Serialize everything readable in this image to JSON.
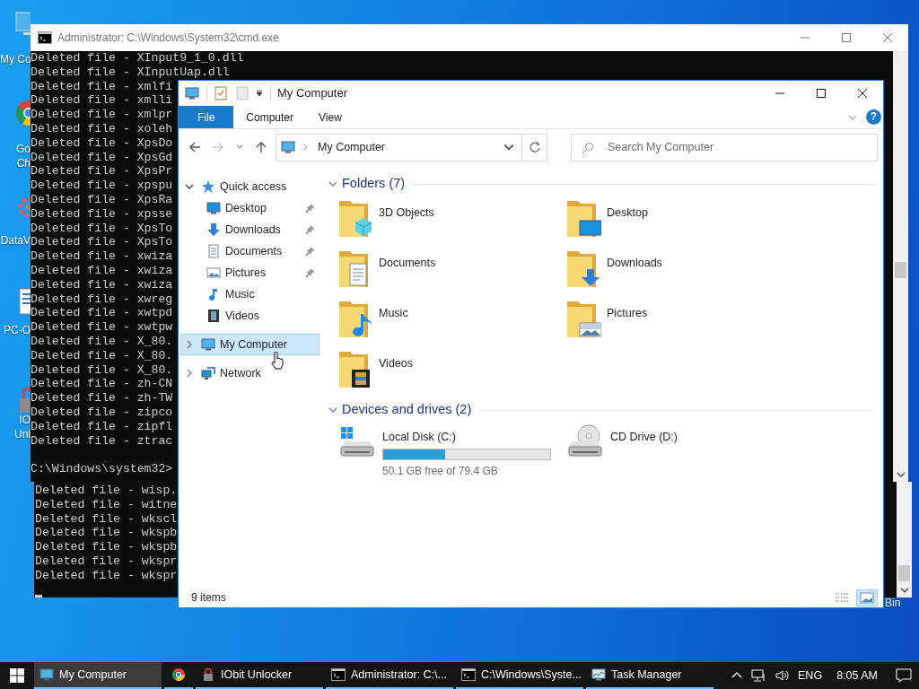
{
  "desktop_icons": [
    {
      "kind": "computer",
      "lines": [
        "My Co"
      ]
    },
    {
      "kind": "browser",
      "lines": [
        "Go",
        "Ch"
      ]
    },
    {
      "kind": "data",
      "lines": [
        "DataV"
      ]
    },
    {
      "kind": "document",
      "lines": [
        "PC-O"
      ]
    },
    {
      "kind": "unlocker",
      "lines": [
        "IO",
        "Unl"
      ]
    },
    {
      "kind": "recycle",
      "lines": [
        "Bin"
      ]
    }
  ],
  "console": {
    "title": "Administrator:  C:\\Windows\\System32\\cmd.exe",
    "lines": [
      "Deleted file - XInput9_1_0.dll",
      "Deleted file - XInputUap.dll",
      "Deleted file - xmlfi",
      "Deleted file - xmlli",
      "Deleted file - xmlpr",
      "Deleted file - xoleh",
      "Deleted file - XpsDo",
      "Deleted file - XpsGd",
      "Deleted file - XpsPr",
      "Deleted file - xpspu",
      "Deleted file - XpsRa",
      "Deleted file - xpsse",
      "Deleted file - XpsTo",
      "Deleted file - XpsTo",
      "Deleted file - xwiza",
      "Deleted file - xwiza",
      "Deleted file - xwiza",
      "Deleted file - xwreg",
      "Deleted file - xwtpd",
      "Deleted file - xwtpw",
      "Deleted file - X_80.",
      "Deleted file - X_80.",
      "Deleted file - X_80.",
      "Deleted file - zh-CN",
      "Deleted file - zh-TW",
      "Deleted file - zipco",
      "Deleted file - zipfl",
      "Deleted file - ztrac"
    ],
    "prompt": "C:\\Windows\\system32>"
  },
  "console_2": {
    "lines": [
      "Deleted file - wisp.",
      "Deleted file - witne",
      "Deleted file - wkscl",
      "Deleted file - wkspb",
      "Deleted file - wkspb",
      "Deleted file - wkspr",
      "Deleted file - wkspr"
    ]
  },
  "explorer": {
    "title": "My Computer",
    "ribbon_tabs": [
      {
        "label": "File",
        "kind": "file"
      },
      {
        "label": "Computer",
        "kind": "tab"
      },
      {
        "label": "View",
        "kind": "tab"
      }
    ],
    "help": "?",
    "address": "My Computer",
    "search": {
      "placeholder": "Search My Computer"
    },
    "nav": [
      {
        "label": "Quick access",
        "kind": "star",
        "expanded": true,
        "selected": false,
        "children": [
          {
            "label": "Desktop",
            "kind": "desktop",
            "pinned": true,
            "selected": false
          },
          {
            "label": "Downloads",
            "kind": "downloads",
            "pinned": true,
            "selected": false
          },
          {
            "label": "Documents",
            "kind": "documents",
            "pinned": true,
            "selected": false
          },
          {
            "label": "Pictures",
            "kind": "pictures",
            "pinned": true,
            "selected": false
          },
          {
            "label": "Music",
            "kind": "music",
            "pinned": false,
            "selected": false
          },
          {
            "label": "Videos",
            "kind": "videos",
            "pinned": false,
            "selected": false
          }
        ]
      },
      {
        "label": "My Computer",
        "kind": "computer",
        "expanded": false,
        "selected": true
      },
      {
        "label": "Network",
        "kind": "network",
        "expanded": false,
        "selected": false
      }
    ],
    "sections": [
      {
        "title": "Folders (7)",
        "expanded": true,
        "items": [
          {
            "label": "3D Objects",
            "kind": "cube"
          },
          {
            "label": "Desktop",
            "kind": "desktop"
          },
          {
            "label": "Documents",
            "kind": "documents"
          },
          {
            "label": "Downloads",
            "kind": "downloads"
          },
          {
            "label": "Music",
            "kind": "music"
          },
          {
            "label": "Pictures",
            "kind": "pictures"
          },
          {
            "label": "Videos",
            "kind": "videos"
          }
        ]
      },
      {
        "title": "Devices and drives (2)",
        "expanded": true,
        "items": [
          {
            "label": "Local Disk (C:)",
            "kind": "disk",
            "level": 0.37,
            "detail": "50.1 GB free of 79.4 GB"
          },
          {
            "label": "CD Drive (D:)",
            "kind": "cd"
          }
        ]
      }
    ],
    "status": "9 items",
    "views": [
      {
        "kind": "details",
        "selected": false
      },
      {
        "kind": "large",
        "selected": true
      }
    ]
  },
  "taskbar": {
    "items": [
      {
        "kind": "explorer",
        "label": "My Computer",
        "selected": true
      },
      {
        "kind": "browser",
        "selected": false
      },
      {
        "kind": "unlocker",
        "label": "IObit Unlocker",
        "selected": false
      },
      {
        "kind": "console",
        "label": "Administrator:  C:\\...",
        "selected": false
      },
      {
        "kind": "console",
        "label": "C:\\Windows\\Syste...",
        "selected": false
      },
      {
        "kind": "taskmgr",
        "label": "Task Manager",
        "selected": false
      }
    ],
    "language": "ENG",
    "time": "8:05 AM"
  }
}
